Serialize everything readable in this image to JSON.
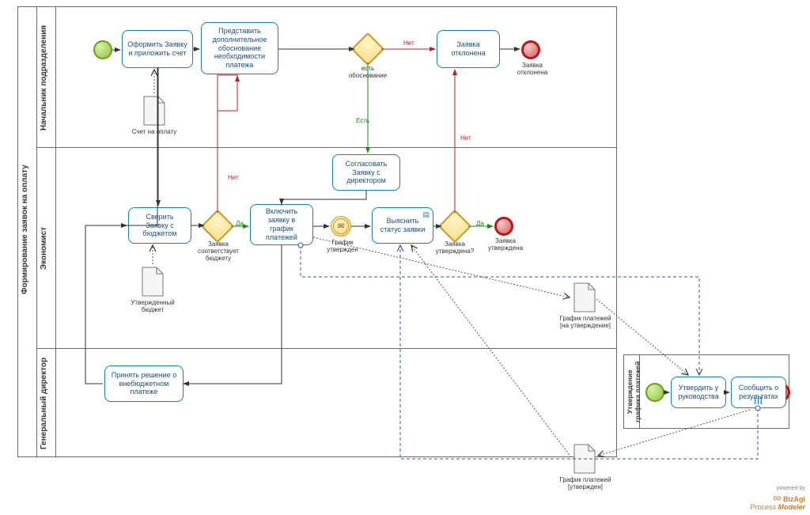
{
  "pool": {
    "title": "Формирование заявок на оплату",
    "lanes": [
      "Начальник подразделения",
      "Экономист",
      "Генеральный директор"
    ]
  },
  "tasks": {
    "t1": "Оформить Заявку и приложить счет",
    "t2": "Представить дополнительное обоснование необходимости платежа",
    "t3": "Заявка отклонена",
    "t4": "Согласовать Заявку с директором",
    "t5": "Сверить Заявку с бюджетом",
    "t6": "Включить заявку в график платежей",
    "t7": "Выяснить статус заявки",
    "t8": "Принять решение о внебюджетном платеже",
    "t9": "Утвердить у руководства",
    "t10": "Сообщить о результатах"
  },
  "gateways": {
    "g1": "есть обоснование",
    "g2": "Заявка соответствует бюджету",
    "g3": "Заявка утверждена?"
  },
  "events": {
    "mid1": "График утвержден",
    "end1": "Заявка отклонена",
    "end2": "Заявка утверждена"
  },
  "data_objects": {
    "d1": "Счет на оплату",
    "d2": "Утвержденный бюджет",
    "d3": "График платежей [на утверждение]",
    "d4": "График платежей [утвержден]"
  },
  "flow_labels": {
    "no1": "Нет",
    "no2": "Нет",
    "no3": "Нет",
    "yes1": "Есть",
    "yes2": "Да",
    "yes3": "Да"
  },
  "subprocess": {
    "title": "Утверждение графика платежей"
  },
  "footer": {
    "powered": "powered by",
    "biz": "BizAgi",
    "pm": "Process Modeler"
  }
}
